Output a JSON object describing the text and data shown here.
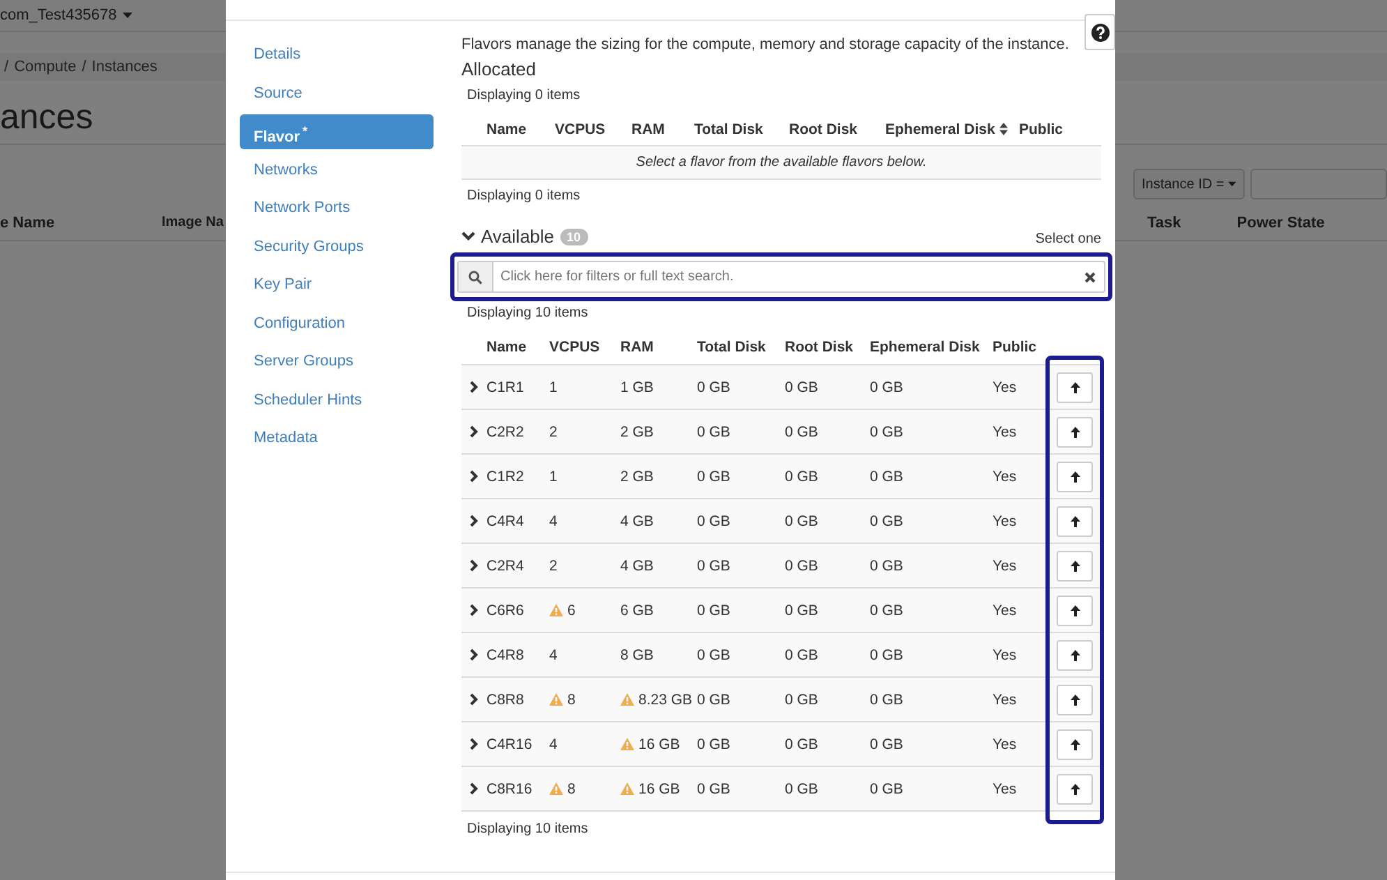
{
  "background_page": {
    "project_menu": "com_Test435678",
    "breadcrumb": {
      "separator": "/",
      "items": [
        "Compute",
        "Instances"
      ]
    },
    "heading": "ances",
    "filter": {
      "button": "Instance ID ="
    },
    "columns_left": [
      "e Name",
      "Image Na"
    ],
    "columns_right": [
      "Task",
      "Power State"
    ]
  },
  "sidebar": {
    "items": [
      {
        "label": "Details",
        "selected": false
      },
      {
        "label": "Source",
        "selected": false
      },
      {
        "label": "Flavor",
        "selected": true,
        "marker": "*"
      },
      {
        "label": "Networks",
        "selected": false
      },
      {
        "label": "Network Ports",
        "selected": false
      },
      {
        "label": "Security Groups",
        "selected": false
      },
      {
        "label": "Key Pair",
        "selected": false
      },
      {
        "label": "Configuration",
        "selected": false
      },
      {
        "label": "Server Groups",
        "selected": false
      },
      {
        "label": "Scheduler Hints",
        "selected": false
      },
      {
        "label": "Metadata",
        "selected": false
      }
    ]
  },
  "description": "Flavors manage the sizing for the compute, memory and storage capacity of the instance.",
  "allocated": {
    "title": "Allocated",
    "count_top": "Displaying 0 items",
    "columns": [
      {
        "label": "Name",
        "sortable": false
      },
      {
        "label": "VCPUS",
        "sortable": false
      },
      {
        "label": "RAM",
        "sortable": false
      },
      {
        "label": "Total Disk",
        "sortable": false
      },
      {
        "label": "Root Disk",
        "sortable": false
      },
      {
        "label": "Ephemeral Disk",
        "sortable": true
      },
      {
        "label": "Public",
        "sortable": false
      }
    ],
    "empty_message": "Select a flavor from the available flavors below.",
    "count_bottom": "Displaying 0 items"
  },
  "available": {
    "title": "Available",
    "expanded": true,
    "badge": "10",
    "hint": "Select one",
    "search": {
      "placeholder": "Click here for filters or full text search."
    },
    "count_top": "Displaying 10 items",
    "columns": [
      "Name",
      "VCPUS",
      "RAM",
      "Total Disk",
      "Root Disk",
      "Ephemeral Disk",
      "Public"
    ],
    "rows": [
      {
        "name": "C1R1",
        "vcpus": {
          "text": "1",
          "warning": false
        },
        "ram": {
          "text": "1 GB",
          "warning": false
        },
        "total_disk": "0 GB",
        "root_disk": "0 GB",
        "ephemeral_disk": "0 GB",
        "public": "Yes"
      },
      {
        "name": "C2R2",
        "vcpus": {
          "text": "2",
          "warning": false
        },
        "ram": {
          "text": "2 GB",
          "warning": false
        },
        "total_disk": "0 GB",
        "root_disk": "0 GB",
        "ephemeral_disk": "0 GB",
        "public": "Yes"
      },
      {
        "name": "C1R2",
        "vcpus": {
          "text": "1",
          "warning": false
        },
        "ram": {
          "text": "2 GB",
          "warning": false
        },
        "total_disk": "0 GB",
        "root_disk": "0 GB",
        "ephemeral_disk": "0 GB",
        "public": "Yes"
      },
      {
        "name": "C4R4",
        "vcpus": {
          "text": "4",
          "warning": false
        },
        "ram": {
          "text": "4 GB",
          "warning": false
        },
        "total_disk": "0 GB",
        "root_disk": "0 GB",
        "ephemeral_disk": "0 GB",
        "public": "Yes"
      },
      {
        "name": "C2R4",
        "vcpus": {
          "text": "2",
          "warning": false
        },
        "ram": {
          "text": "4 GB",
          "warning": false
        },
        "total_disk": "0 GB",
        "root_disk": "0 GB",
        "ephemeral_disk": "0 GB",
        "public": "Yes"
      },
      {
        "name": "C6R6",
        "vcpus": {
          "text": "6",
          "warning": true
        },
        "ram": {
          "text": "6 GB",
          "warning": false
        },
        "total_disk": "0 GB",
        "root_disk": "0 GB",
        "ephemeral_disk": "0 GB",
        "public": "Yes"
      },
      {
        "name": "C4R8",
        "vcpus": {
          "text": "4",
          "warning": false
        },
        "ram": {
          "text": "8 GB",
          "warning": false
        },
        "total_disk": "0 GB",
        "root_disk": "0 GB",
        "ephemeral_disk": "0 GB",
        "public": "Yes"
      },
      {
        "name": "C8R8",
        "vcpus": {
          "text": "8",
          "warning": true
        },
        "ram": {
          "text": "8.23 GB",
          "warning": true
        },
        "total_disk": "0 GB",
        "root_disk": "0 GB",
        "ephemeral_disk": "0 GB",
        "public": "Yes"
      },
      {
        "name": "C4R16",
        "vcpus": {
          "text": "4",
          "warning": false
        },
        "ram": {
          "text": "16 GB",
          "warning": true
        },
        "total_disk": "0 GB",
        "root_disk": "0 GB",
        "ephemeral_disk": "0 GB",
        "public": "Yes"
      },
      {
        "name": "C8R16",
        "vcpus": {
          "text": "8",
          "warning": true
        },
        "ram": {
          "text": "16 GB",
          "warning": true
        },
        "total_disk": "0 GB",
        "root_disk": "0 GB",
        "ephemeral_disk": "0 GB",
        "public": "Yes"
      }
    ],
    "count_bottom": "Displaying 10 items"
  }
}
